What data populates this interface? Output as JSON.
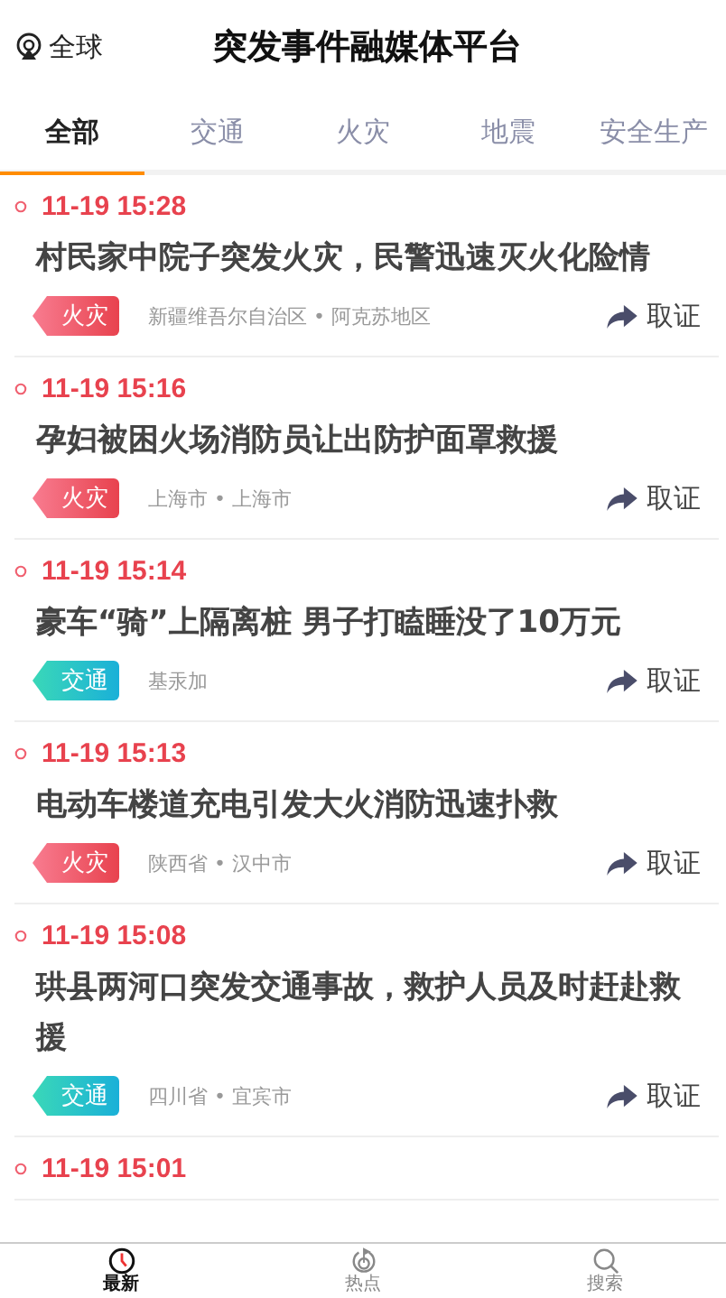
{
  "header": {
    "region": "全球",
    "title": "突发事件融媒体平台"
  },
  "tabs": [
    {
      "label": "全部",
      "selected": true
    },
    {
      "label": "交通",
      "selected": false
    },
    {
      "label": "火灾",
      "selected": false
    },
    {
      "label": "地震",
      "selected": false
    },
    {
      "label": "安全生产",
      "selected": false
    }
  ],
  "news": [
    {
      "time": "11-19 15:28",
      "title": "村民家中院子突发火灾，民警迅速灭火化险情",
      "tag": {
        "label": "火灾",
        "kind": "fire"
      },
      "location": "新疆维吾尔自治区 • 阿克苏地区",
      "action": "取证"
    },
    {
      "time": "11-19 15:16",
      "title": "孕妇被困火场消防员让出防护面罩救援",
      "tag": {
        "label": "火灾",
        "kind": "fire"
      },
      "location": "上海市 • 上海市",
      "action": "取证"
    },
    {
      "time": "11-19 15:14",
      "title": "豪车“骑”上隔离桩 男子打瞌睡没了10万元",
      "tag": {
        "label": "交通",
        "kind": "traffic"
      },
      "location": "基汞加",
      "action": "取证"
    },
    {
      "time": "11-19 15:13",
      "title": "电动车楼道充电引发大火消防迅速扑救",
      "tag": {
        "label": "火灾",
        "kind": "fire"
      },
      "location": "陕西省 • 汉中市",
      "action": "取证"
    },
    {
      "time": "11-19 15:08",
      "title": "珙县两河口突发交通事故，救护人员及时赶赴救援",
      "tag": {
        "label": "交通",
        "kind": "traffic"
      },
      "location": "四川省 • 宜宾市",
      "action": "取证"
    },
    {
      "time": "11-19 15:01"
    }
  ],
  "bottom_nav": [
    {
      "label": "最新",
      "selected": true,
      "kind": "latest"
    },
    {
      "label": "热点",
      "selected": false,
      "kind": "hot"
    },
    {
      "label": "搜索",
      "selected": false,
      "kind": "search"
    }
  ]
}
